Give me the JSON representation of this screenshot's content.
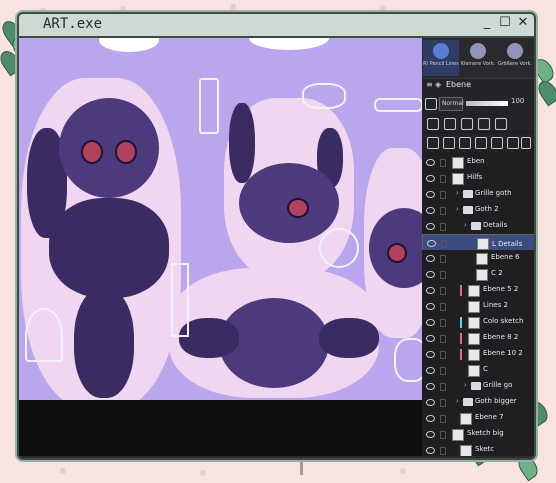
{
  "window": {
    "title": "ART.exe",
    "minimize_label": "_",
    "maximize_label": "☐",
    "close_label": "✕"
  },
  "panel": {
    "tabs": [
      {
        "label": "Ri Pencil Lines"
      },
      {
        "label": "Kleinere Vork."
      },
      {
        "label": "Größere Vork."
      }
    ],
    "layer_name_field": "Ebene",
    "blend_mode": "Normal",
    "opacity": "100"
  },
  "layers": [
    {
      "name": "Eben",
      "type": "layer",
      "indent": 0
    },
    {
      "name": "Hilfs",
      "type": "layer",
      "indent": 0
    },
    {
      "name": "Grille goth",
      "type": "folder",
      "indent": 1
    },
    {
      "name": "Goth 2",
      "type": "folder",
      "indent": 1
    },
    {
      "name": "Details",
      "type": "folder",
      "indent": 2
    },
    {
      "name": "L Details",
      "type": "layer",
      "indent": 3,
      "selected": true
    },
    {
      "name": "Ebene 6",
      "type": "layer",
      "indent": 3
    },
    {
      "name": "C 2",
      "type": "layer",
      "indent": 3
    },
    {
      "name": "Ebene 5 2",
      "type": "layer",
      "indent": 2,
      "color": "#e56a7c"
    },
    {
      "name": "Lines 2",
      "type": "layer",
      "indent": 2
    },
    {
      "name": "Colo sketch",
      "type": "layer",
      "indent": 2,
      "color": "#6ad3e0"
    },
    {
      "name": "Ebene 8 2",
      "type": "layer",
      "indent": 2,
      "color": "#e56a7c"
    },
    {
      "name": "Ebene 10 2",
      "type": "layer",
      "indent": 2,
      "color": "#e56a7c"
    },
    {
      "name": "C",
      "type": "layer",
      "indent": 2
    },
    {
      "name": "Grille go",
      "type": "folder",
      "indent": 2
    },
    {
      "name": "Goth bigger",
      "type": "folder",
      "indent": 1
    },
    {
      "name": "Ebene 7",
      "type": "layer",
      "indent": 1
    },
    {
      "name": "Sketch big",
      "type": "layer",
      "indent": 0
    },
    {
      "name": "Sketc",
      "type": "layer",
      "indent": 1
    }
  ]
}
